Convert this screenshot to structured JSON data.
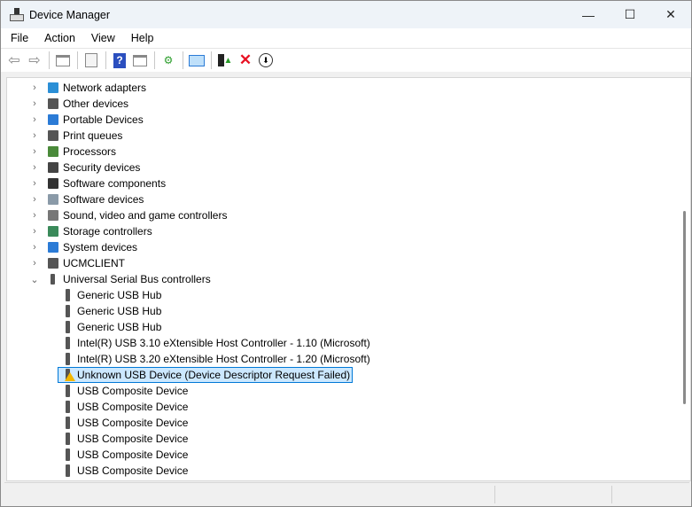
{
  "window": {
    "title": "Device Manager",
    "minimize": "—",
    "maximize": "☐",
    "close": "✕"
  },
  "menu": [
    "File",
    "Action",
    "View",
    "Help"
  ],
  "toolbar": [
    "back-icon",
    "forward-icon",
    "show-hide-console-tree-icon",
    "properties-icon",
    "help-icon",
    "show-action-pane-icon",
    "update-driver-icon",
    "scan-hardware-icon",
    "enable-device-icon",
    "uninstall-device-icon",
    "disable-device-icon"
  ],
  "tree": {
    "categories": [
      {
        "label": "Network adapters",
        "icon": "network-icon",
        "expanded": false
      },
      {
        "label": "Other devices",
        "icon": "other-devices-icon",
        "expanded": false
      },
      {
        "label": "Portable Devices",
        "icon": "portable-icon",
        "expanded": false
      },
      {
        "label": "Print queues",
        "icon": "printer-icon",
        "expanded": false
      },
      {
        "label": "Processors",
        "icon": "processor-icon",
        "expanded": false
      },
      {
        "label": "Security devices",
        "icon": "security-icon",
        "expanded": false
      },
      {
        "label": "Software components",
        "icon": "software-components-icon",
        "expanded": false
      },
      {
        "label": "Software devices",
        "icon": "software-devices-icon",
        "expanded": false
      },
      {
        "label": "Sound, video and game controllers",
        "icon": "speaker-icon",
        "expanded": false
      },
      {
        "label": "Storage controllers",
        "icon": "storage-icon",
        "expanded": false
      },
      {
        "label": "System devices",
        "icon": "system-icon",
        "expanded": false
      },
      {
        "label": "UCMCLIENT",
        "icon": "ucm-icon",
        "expanded": false
      },
      {
        "label": "Universal Serial Bus controllers",
        "icon": "usb-icon",
        "expanded": true
      }
    ],
    "usb_children": [
      {
        "label": "Generic USB Hub"
      },
      {
        "label": "Generic USB Hub"
      },
      {
        "label": "Generic USB Hub"
      },
      {
        "label": "Intel(R) USB 3.10 eXtensible Host Controller - 1.10 (Microsoft)"
      },
      {
        "label": "Intel(R) USB 3.20 eXtensible Host Controller - 1.20 (Microsoft)"
      },
      {
        "label": "Unknown USB Device (Device Descriptor Request Failed)",
        "warning": true,
        "selected": true
      },
      {
        "label": "USB Composite Device"
      },
      {
        "label": "USB Composite Device"
      },
      {
        "label": "USB Composite Device"
      },
      {
        "label": "USB Composite Device"
      },
      {
        "label": "USB Composite Device"
      },
      {
        "label": "USB Composite Device"
      }
    ]
  },
  "colors": {
    "selection": "#cce8ff",
    "selection_border": "#0078d7",
    "delete_red": "#e81123"
  }
}
